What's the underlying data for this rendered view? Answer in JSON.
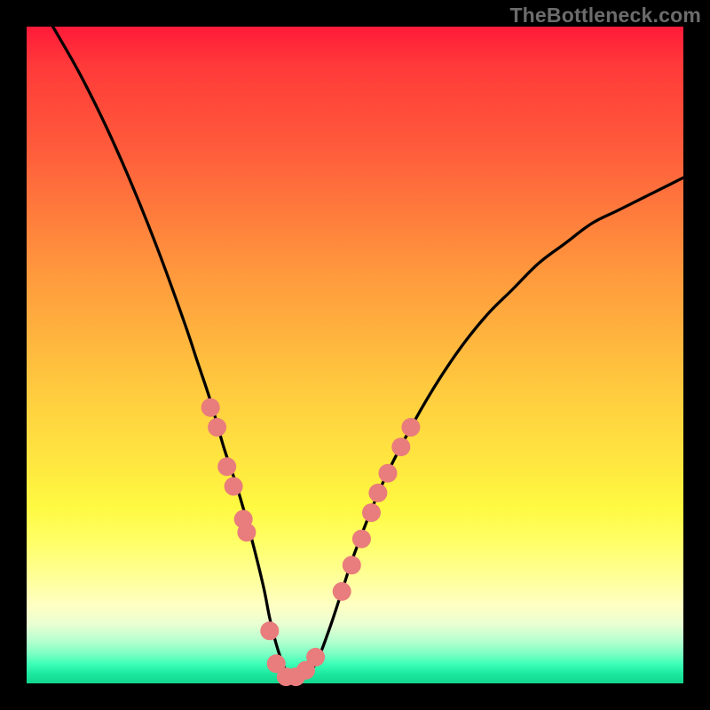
{
  "watermark": "TheBottleneck.com",
  "colors": {
    "bg": "#000000",
    "gradient_top": "#ff1a3a",
    "gradient_bottom": "#12d68e",
    "curve_stroke": "#000000",
    "point_fill": "#e97c7c",
    "point_stroke": "#b74848"
  },
  "chart_data": {
    "type": "line",
    "title": "",
    "xlabel": "",
    "ylabel": "",
    "xlim": [
      0,
      100
    ],
    "ylim": [
      0,
      100
    ],
    "series": [
      {
        "name": "curve",
        "x": [
          4,
          8,
          12,
          16,
          20,
          24,
          26,
          28,
          30,
          32,
          34,
          36,
          37,
          38,
          39,
          40,
          41,
          42,
          44,
          46,
          48,
          50,
          54,
          58,
          62,
          66,
          70,
          74,
          78,
          82,
          86,
          90,
          94,
          98,
          100
        ],
        "y": [
          100,
          93,
          85,
          76,
          66,
          55,
          49,
          43,
          36,
          30,
          23,
          15,
          10,
          6,
          3,
          1,
          1,
          1,
          3,
          8,
          14,
          20,
          30,
          38,
          45,
          51,
          56,
          60,
          64,
          67,
          70,
          72,
          74,
          76,
          77
        ]
      }
    ],
    "points": [
      {
        "x": 28,
        "y": 42
      },
      {
        "x": 29,
        "y": 39
      },
      {
        "x": 30.5,
        "y": 33
      },
      {
        "x": 31.5,
        "y": 30
      },
      {
        "x": 33,
        "y": 25
      },
      {
        "x": 33.5,
        "y": 23
      },
      {
        "x": 37,
        "y": 8
      },
      {
        "x": 38,
        "y": 3
      },
      {
        "x": 39.5,
        "y": 1
      },
      {
        "x": 41,
        "y": 1
      },
      {
        "x": 42.5,
        "y": 2
      },
      {
        "x": 44,
        "y": 4
      },
      {
        "x": 48,
        "y": 14
      },
      {
        "x": 49.5,
        "y": 18
      },
      {
        "x": 51,
        "y": 22
      },
      {
        "x": 52.5,
        "y": 26
      },
      {
        "x": 53.5,
        "y": 29
      },
      {
        "x": 55,
        "y": 32
      },
      {
        "x": 57,
        "y": 36
      },
      {
        "x": 58.5,
        "y": 39
      }
    ]
  }
}
